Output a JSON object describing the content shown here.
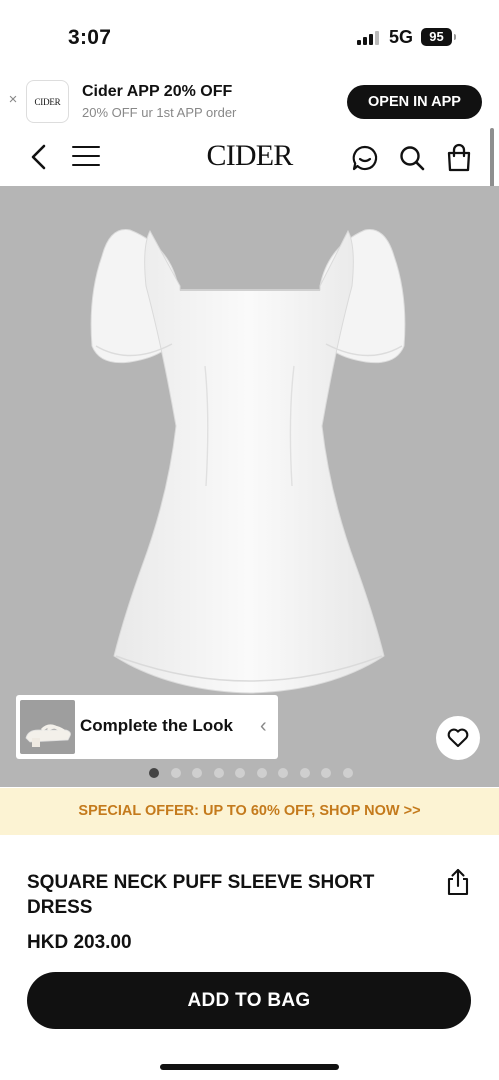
{
  "status_bar": {
    "time": "3:07",
    "network": "5G",
    "battery": "95"
  },
  "app_banner": {
    "logo_text": "CIDER",
    "title": "Cider APP 20% OFF",
    "subtitle": "20% OFF ur 1st APP order",
    "button_label": "OPEN IN APP",
    "close_symbol": "×"
  },
  "nav": {
    "logo": "CIDER",
    "icons": [
      "chevron-left-icon",
      "menu-icon",
      "chat-icon",
      "search-icon",
      "bag-icon"
    ]
  },
  "gallery": {
    "complete_look_label": "Complete the Look",
    "complete_look_arrow": "‹",
    "dot_count": 10,
    "active_dot": 0
  },
  "promo": {
    "text": "SPECIAL OFFER: UP TO 60% OFF, SHOP NOW >>"
  },
  "product": {
    "title": "SQUARE NECK PUFF SLEEVE SHORT DRESS",
    "price": "HKD 203.00",
    "add_to_bag_label": "ADD TO BAG"
  },
  "colors": {
    "accent": "#111111",
    "promo_bg": "#fcf3d3",
    "promo_text": "#c47a1c",
    "image_bg": "#b5b5b5"
  }
}
